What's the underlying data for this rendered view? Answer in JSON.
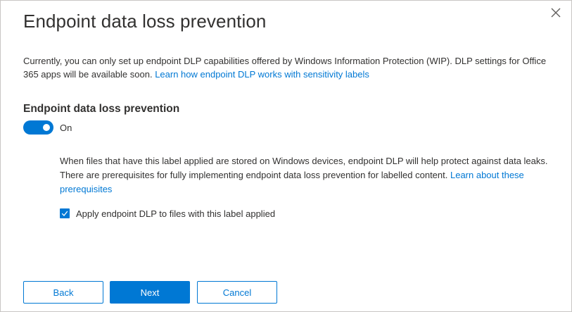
{
  "dialog": {
    "title": "Endpoint data loss prevention",
    "close_icon": "close-icon"
  },
  "intro": {
    "text": "Currently, you can only set up endpoint DLP capabilities offered by Windows Information Protection (WIP). DLP settings for Office 365 apps will be available soon. ",
    "link": "Learn how endpoint DLP works with sensitivity labels"
  },
  "section": {
    "title": "Endpoint data loss prevention",
    "toggle": {
      "state": "On",
      "checked": true
    },
    "info_text": "When files that have this label applied are stored on Windows devices, endpoint DLP will help protect against data leaks. There are prerequisites for fully implementing endpoint data loss prevention for labelled content. ",
    "info_link": "Learn about these prerequisites",
    "checkbox": {
      "label": "Apply endpoint DLP to files with this label applied",
      "checked": true
    }
  },
  "footer": {
    "back_label": "Back",
    "next_label": "Next",
    "cancel_label": "Cancel"
  },
  "colors": {
    "accent": "#0078d4",
    "text": "#323130",
    "border": "#c8c6c4"
  }
}
